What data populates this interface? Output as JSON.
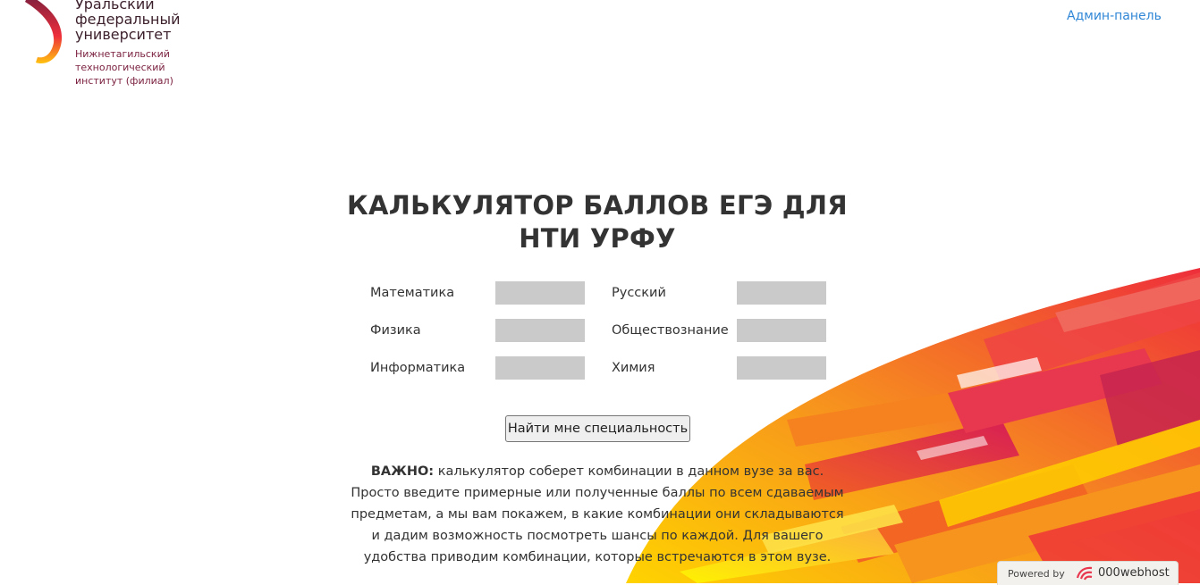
{
  "header": {
    "logo_title": "Уральский федеральный университет",
    "logo_sub": "Нижнетагильский технологический институт (филиал)",
    "admin_link": "Админ-панель"
  },
  "main": {
    "title": "КАЛЬКУЛЯТОР БАЛЛОВ ЕГЭ ДЛЯ НТИ УРФУ",
    "subjects": {
      "math": "Математика",
      "russian": "Русский",
      "physics": "Физика",
      "social": "Обществознание",
      "informatics": "Информатика",
      "chemistry": "Химия"
    },
    "inputs": {
      "math": "",
      "russian": "",
      "physics": "",
      "social": "",
      "informatics": "",
      "chemistry": ""
    },
    "button_label": "Найти мне специальность",
    "info_bold": "ВАЖНО:",
    "info_text": " калькулятор соберет комбинации в данном вузе за вас. Просто введите примерные или полученные баллы по всем сдаваемым предметам, а мы вам покажем, в какие комбинации они складываются и дадим возможность посмотреть шансы по каждой. Для вашего удобства приводим комбинации, которые встречаются в этом вузе."
  },
  "footer": {
    "powered_label": "Powered by",
    "powered_brand": "000webhost"
  },
  "colors": {
    "link": "#2f86d6",
    "input_bg": "#cacaca",
    "title": "#333333",
    "logo_title": "#3b1f2b",
    "logo_sub": "#7a1f3e"
  }
}
